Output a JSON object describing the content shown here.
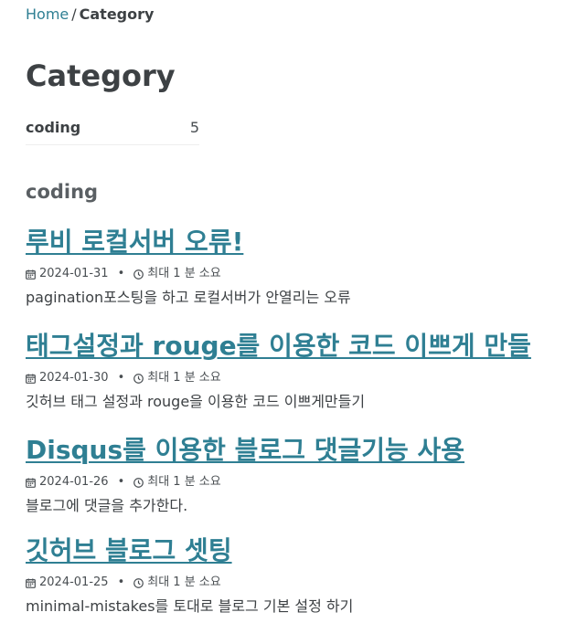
{
  "breadcrumb": {
    "home": "Home",
    "separator": "/",
    "current": "Category"
  },
  "page_title": "Category",
  "taxonomy": [
    {
      "label": "coding",
      "count": "5"
    }
  ],
  "section_title": "coding",
  "posts": [
    {
      "title": "루비 로컬서버 오류!",
      "date": "2024-01-31",
      "read_time": "최대 1 분 소요",
      "excerpt": "pagination포스팅을 하고 로컬서버가 안열리는 오류"
    },
    {
      "title": "태그설정과 rouge를 이용한 코드 이쁘게 만들",
      "date": "2024-01-30",
      "read_time": "최대 1 분 소요",
      "excerpt": "깃허브 태그 설정과 rouge을 이용한 코드 이쁘게만들기"
    },
    {
      "title": "Disqus를 이용한 블로그 댓글기능 사용",
      "date": "2024-01-26",
      "read_time": "최대 1 분 소요",
      "excerpt": "블로그에 댓글을 추가한다."
    },
    {
      "title": "깃허브 블로그 셋팅",
      "date": "2024-01-25",
      "read_time": "최대 1 분 소요",
      "excerpt": "minimal-mistakes를 토대로 블로그 기본 설정 하기"
    }
  ],
  "meta_separator": "•",
  "colors": {
    "link": "#2f7f93",
    "text": "#3d4144",
    "section_title": "#5a5f63"
  },
  "icons": {
    "date": "calendar-icon",
    "read_time": "clock-icon"
  }
}
